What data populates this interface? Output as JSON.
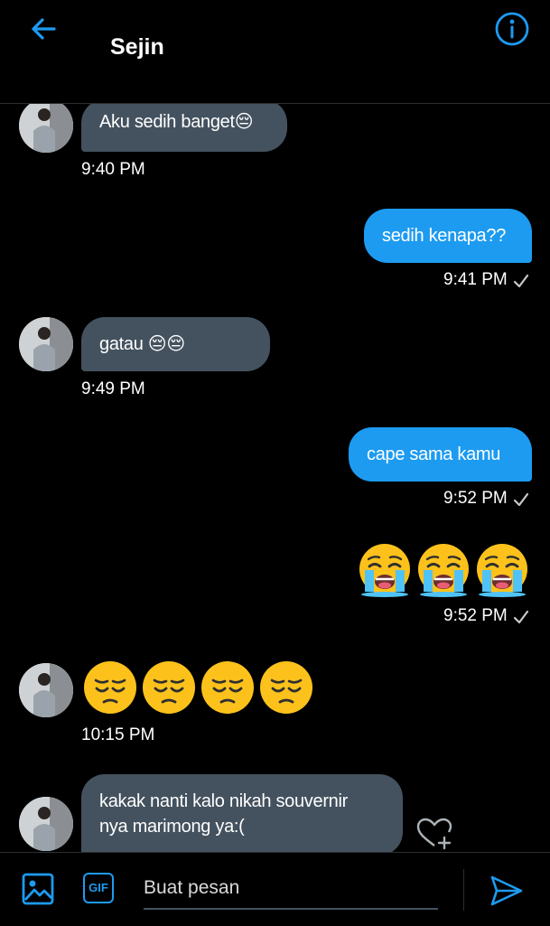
{
  "header": {
    "title": "Sejin",
    "back_icon": "arrow-left-icon",
    "info_icon": "info-icon",
    "accent": "#1d9bf0"
  },
  "messages": [
    {
      "dir": "in",
      "text": "Aku sedih banget😔",
      "time": "9:40 PM"
    },
    {
      "dir": "out",
      "text": "sedih kenapa??",
      "time": "9:41 PM",
      "status": "sent"
    },
    {
      "dir": "in",
      "text": "gatau 😔😔",
      "time": "9:49 PM"
    },
    {
      "dir": "out",
      "text": "cape sama kamu",
      "time": "9:52 PM",
      "status": "sent"
    },
    {
      "dir": "out",
      "emoji": [
        "😭",
        "😭",
        "😭"
      ],
      "time": "9:52 PM",
      "status": "sent"
    },
    {
      "dir": "in",
      "emoji": [
        "😔",
        "😔",
        "😔",
        "😔"
      ],
      "time": "10:15 PM"
    },
    {
      "dir": "in",
      "text_lines": [
        "kakak nanti kalo nikah souvernir",
        "nya marimong ya:("
      ]
    }
  ],
  "composer": {
    "placeholder": "Buat pesan",
    "gif_label": "GIF",
    "media_icon": "image-icon",
    "send_icon": "send-icon",
    "react_icon": "heart-plus-icon"
  },
  "colors": {
    "background": "#000000",
    "incoming_bubble": "#44525f",
    "outgoing_bubble": "#1d9bf0"
  }
}
